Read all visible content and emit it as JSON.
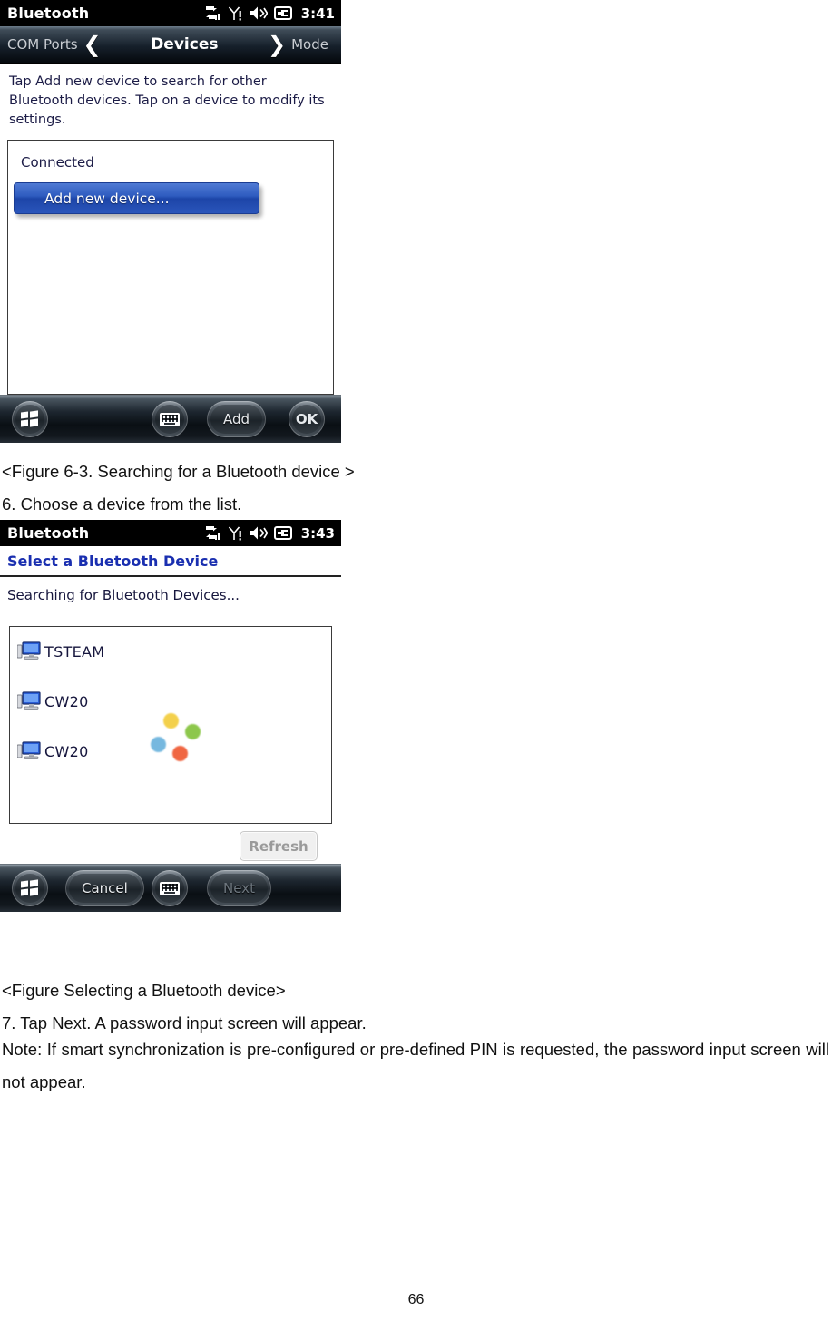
{
  "document": {
    "page_number": "66",
    "caption_1": "<Figure 6-3. Searching for a Bluetooth device >",
    "step_6": "6. Choose a device from the list.",
    "caption_2": "<Figure Selecting a Bluetooth device>",
    "step_7": "7. Tap Next. A password input screen will appear.",
    "note": "Note: If smart synchronization is pre-configured or pre-defined PIN is requested, the password input screen will not appear."
  },
  "screenshot_devices": {
    "titlebar": {
      "title": "Bluetooth",
      "clock": "3:41",
      "icons": [
        "connectivity-icon",
        "signal-alert-icon",
        "speaker-icon",
        "power-plug-icon"
      ]
    },
    "navbar": {
      "left_label": "COM Ports",
      "center_label": "Devices",
      "right_label": "Mode",
      "prev_arrow": "❮",
      "next_arrow": "❯"
    },
    "hint": "Tap Add new device to search for other Bluetooth devices. Tap on a device to modify its settings.",
    "list": {
      "group_label": "Connected",
      "add_button_label": "Add new device..."
    },
    "softkeys": {
      "start_label": "start-icon",
      "keyboard_label": "keyboard-icon",
      "add_label": "Add",
      "ok_label": "OK"
    }
  },
  "screenshot_select": {
    "titlebar": {
      "title": "Bluetooth",
      "clock": "3:43"
    },
    "page_title": "Select a Bluetooth Device",
    "status_text": "Searching for Bluetooth Devices...",
    "devices": [
      {
        "name": "TSTEAM",
        "icon": "computer-icon"
      },
      {
        "name": "CW20",
        "icon": "computer-icon"
      },
      {
        "name": "CW20",
        "icon": "computer-icon"
      }
    ],
    "spinner_colors": [
      "#f3cd3d",
      "#84c33d",
      "#6bb3dd",
      "#ef5a33"
    ],
    "refresh_label": "Refresh",
    "softkeys": {
      "start_label": "start-icon",
      "cancel_label": "Cancel",
      "keyboard_label": "keyboard-icon",
      "next_label": "Next"
    }
  },
  "colors": {
    "accent_blue": "#1a2fb0",
    "button_blue": "#2f5cc0",
    "titlebar_black": "#000000"
  }
}
